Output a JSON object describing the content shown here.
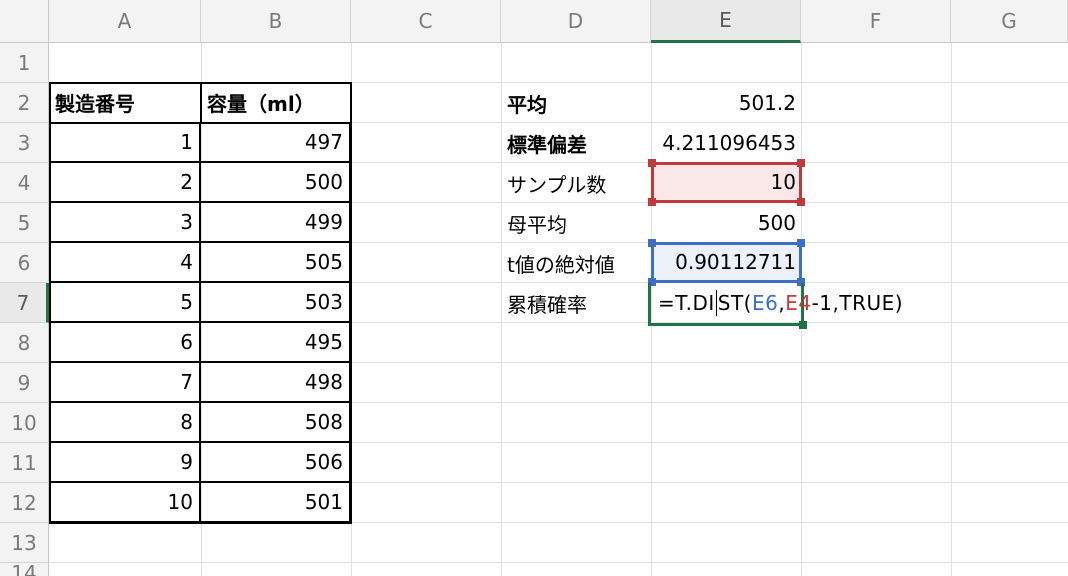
{
  "columns": [
    "A",
    "B",
    "C",
    "D",
    "E",
    "F",
    "G"
  ],
  "rows": [
    "1",
    "2",
    "3",
    "4",
    "5",
    "6",
    "7",
    "8",
    "9",
    "10",
    "11",
    "12",
    "13",
    "14"
  ],
  "table": {
    "header_a": "製造番号",
    "header_b": "容量（ml）",
    "ids": [
      "1",
      "2",
      "3",
      "4",
      "5",
      "6",
      "7",
      "8",
      "9",
      "10"
    ],
    "volumes": [
      "497",
      "500",
      "499",
      "505",
      "503",
      "495",
      "498",
      "508",
      "506",
      "501"
    ]
  },
  "stats": {
    "labels": [
      "平均",
      "標準偏差",
      "サンプル数",
      "母平均",
      "t値の絶対値",
      "累積確率"
    ],
    "values": [
      "501.2",
      "4.211096453",
      "10",
      "500",
      "0.90112711"
    ]
  },
  "formula": {
    "prefix": "=T.DI",
    "middle": "ST(",
    "ref1": "E6",
    "comma": ",",
    "ref2": "E4",
    "suffix": "-1,TRUE)"
  },
  "colors": {
    "active_green": "#217346",
    "ref_red": "#c0393b",
    "ref_blue": "#3d6fc7"
  }
}
